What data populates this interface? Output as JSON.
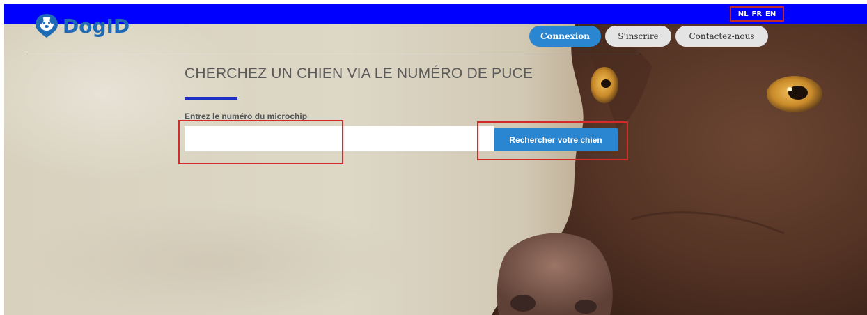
{
  "header": {
    "languages": [
      "NL",
      "FR",
      "EN"
    ]
  },
  "brand": {
    "name": "DogID",
    "color": "#1f6ab5"
  },
  "nav": {
    "login": "Connexion",
    "register": "S'inscrire",
    "contact": "Contactez-nous"
  },
  "main": {
    "title": "CHERCHEZ UN CHIEN VIA LE NUMÉRO DE PUCE",
    "input_label": "Entrez le numéro du microchip",
    "input_value": "",
    "search_button": "Rechercher votre chien"
  },
  "colors": {
    "topbar": "#0000ff",
    "primary": "#2b86d1",
    "accent": "#1e2fc5",
    "highlight": "#d42a2a"
  }
}
